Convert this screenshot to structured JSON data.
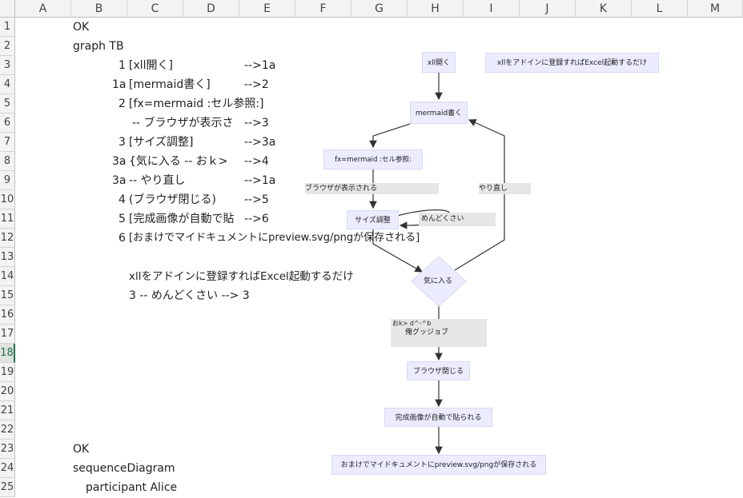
{
  "columns": [
    "A",
    "B",
    "C",
    "D",
    "E",
    "F",
    "G",
    "H",
    "I",
    "J",
    "K",
    "L",
    "M"
  ],
  "rows": [
    "1",
    "2",
    "3",
    "4",
    "5",
    "6",
    "7",
    "8",
    "9",
    "10",
    "11",
    "12",
    "13",
    "14",
    "15",
    "16",
    "17",
    "18",
    "19",
    "20",
    "21",
    "22",
    "23",
    "24",
    "25"
  ],
  "selected_row": "18",
  "cells": {
    "b1": "OK",
    "b2": "graph TB",
    "r3_id": "1",
    "r3_text": "[xll開く]",
    "r3_arrow": "-->1a",
    "r4_id": "1a",
    "r4_text": "[mermaid書く]",
    "r4_arrow": "-->2",
    "r5_id": "2",
    "r5_text": "[fx=mermaid :セル参照:]",
    "r6_text": "-- ブラウザが表示さ",
    "r6_arrow": "-->3",
    "r7_id": "3",
    "r7_text": "[サイズ調整]",
    "r7_arrow": "-->3a",
    "r8_id": "3a",
    "r8_text": "{気に入る  -- おｋ>",
    "r8_arrow": "-->4",
    "r9_id": "3a",
    "r9_text": " -- やり直し",
    "r9_arrow": "-->1a",
    "r10_id": "4",
    "r10_text": "(ブラウザ閉じる)",
    "r10_arrow": "-->5",
    "r11_id": "5",
    "r11_text": "[完成画像が自動で貼",
    "r11_arrow": "-->6",
    "r12_id": "6",
    "r12_text": "[おまけでマイドキュメントにpreview.svg/pngが保存される]",
    "r14_text": "xllをアドインに登録すればExcel起動するだけ",
    "r15_text": "3 -- めんどくさい -->  3",
    "b23": "OK",
    "b24": "sequenceDiagram",
    "b25": "participant Alice"
  },
  "diagram": {
    "nodes": {
      "xll_open": "xll開く",
      "note": "xllをアドインに登録すればExcel起動するだけ",
      "mermaid_write": "mermaid書く",
      "fx_mermaid": "fx=mermaid :セル参照:",
      "size_adjust": "サイズ調整",
      "like_it": "気に入る",
      "browser_close": "ブラウザ閉じる",
      "auto_paste": "完成画像が自動で貼られる",
      "bonus_save": "おまけでマイドキュメントにpreview.svg/pngが保存される"
    },
    "edge_labels": {
      "browser_shown": "ブラウザが表示される",
      "redo": "やり直し",
      "tedious": "めんどくさい",
      "ok_line1": "おk> d^-^b",
      "ok_line2": "俺グッジョブ"
    },
    "node_fill": "#ececff",
    "node_border": "#d8d8f6",
    "edge_color": "#333333"
  }
}
